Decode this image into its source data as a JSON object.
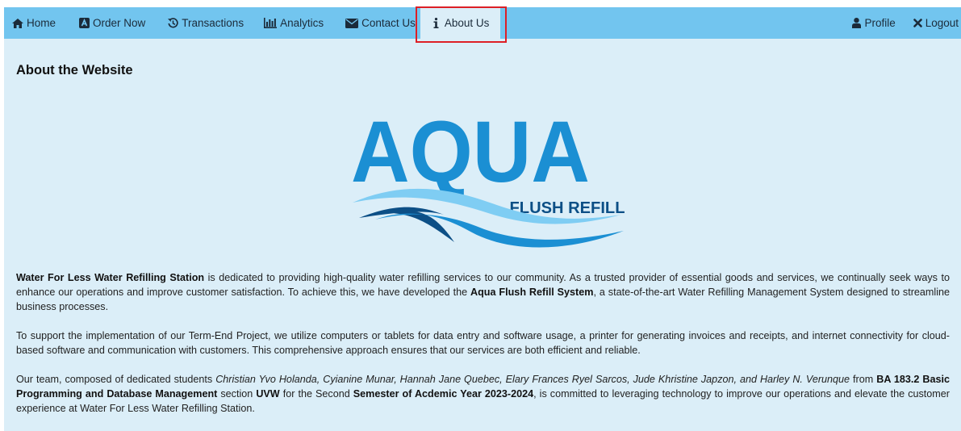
{
  "nav": {
    "home": "Home",
    "order": "Order Now",
    "transactions": "Transactions",
    "analytics": "Analytics",
    "contact": "Contact Us",
    "about": "About Us",
    "profile": "Profile",
    "logout": "Logout"
  },
  "page": {
    "heading": "About the Website",
    "logo": {
      "main": "AQUA",
      "sub": "FLUSH REFILL"
    }
  },
  "paragraphs": {
    "p1": {
      "s1": "Water For Less Water Refilling Station",
      "t1": " is dedicated to providing high-quality water refilling services to our community. As a trusted provider of essential goods and services, we continually seek ways to enhance our operations and improve customer satisfaction. To achieve this, we have developed the ",
      "s2": "Aqua Flush Refill System",
      "t2": ", a state-of-the-art Water Refilling Management System designed to streamline business processes."
    },
    "p2": {
      "t1": "To support the implementation of our Term-End Project, we utilize computers or tablets for data entry and software usage, a printer for generating invoices and receipts, and internet connectivity for cloud-based software and communication with customers. This comprehensive approach ensures that our services are both efficient and reliable."
    },
    "p3": {
      "t1": "Our team, composed of dedicated students ",
      "names": "Christian Yvo Holanda, Cyianine Munar, Hannah Jane Quebec, Elary Frances Ryel Sarcos, Jude Khristine Japzon, and Harley N. Verunque",
      "t2": " from ",
      "course": "BA 183.2 Basic Programming and Database Management",
      "t3": " section ",
      "section": "UVW",
      "t4": " for the Second ",
      "semester": "Semester of Acdemic Year 2023-2024",
      "t5": ", is committed to leveraging technology to improve our operations and elevate the customer experience at Water For Less Water Refilling Station."
    }
  },
  "colors": {
    "navbar": "#72c5ef",
    "page_bg": "#dbeef8",
    "logo_blue": "#1b8fd3",
    "logo_dark": "#0c4f86",
    "highlight": "#dd1f26"
  },
  "icons": [
    "home-icon",
    "order-icon",
    "history-icon",
    "bar-chart-icon",
    "envelope-icon",
    "info-icon",
    "user-icon",
    "close-icon"
  ]
}
